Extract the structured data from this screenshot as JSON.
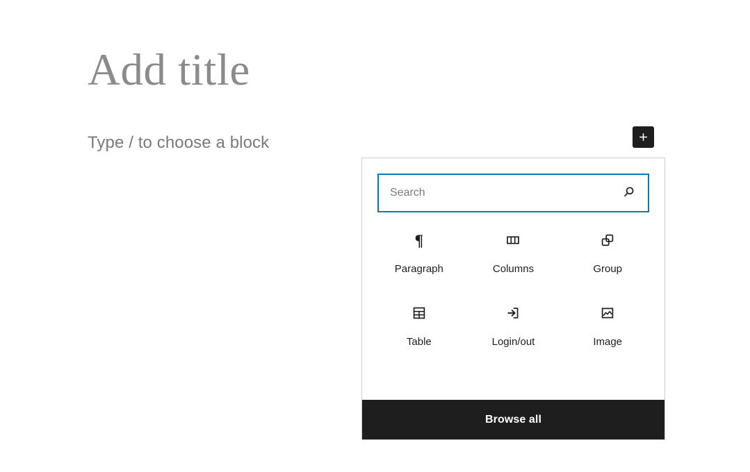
{
  "editor": {
    "title_placeholder": "Add title",
    "block_prompt": "Type / to choose a block"
  },
  "inserter_toggle": {
    "icon": "plus-icon",
    "label": "Add block",
    "background_color": "#1e1e1e",
    "icon_color": "#ffffff"
  },
  "inserter": {
    "search": {
      "value": "",
      "placeholder": "Search",
      "icon": "search-icon",
      "border_color": "#007cba"
    },
    "blocks": [
      {
        "label": "Paragraph",
        "icon": "paragraph-pilcrow-icon"
      },
      {
        "label": "Columns",
        "icon": "columns-icon"
      },
      {
        "label": "Group",
        "icon": "group-overlapping-squares-icon"
      },
      {
        "label": "Table",
        "icon": "table-grid-icon"
      },
      {
        "label": "Login/out",
        "icon": "login-arrow-icon"
      },
      {
        "label": "Image",
        "icon": "image-picture-icon"
      }
    ],
    "footer": {
      "browse_all_label": "Browse all",
      "background_color": "#1e1e1e",
      "text_color": "#ffffff"
    },
    "border_color": "#cccccc",
    "background_color": "#ffffff"
  },
  "theme": {
    "canvas_background": "#ffffff",
    "title_color": "#8b8b8b",
    "prompt_color": "#7a7a7a",
    "label_color": "#1e1e1e",
    "accent_blue": "#007cba"
  }
}
